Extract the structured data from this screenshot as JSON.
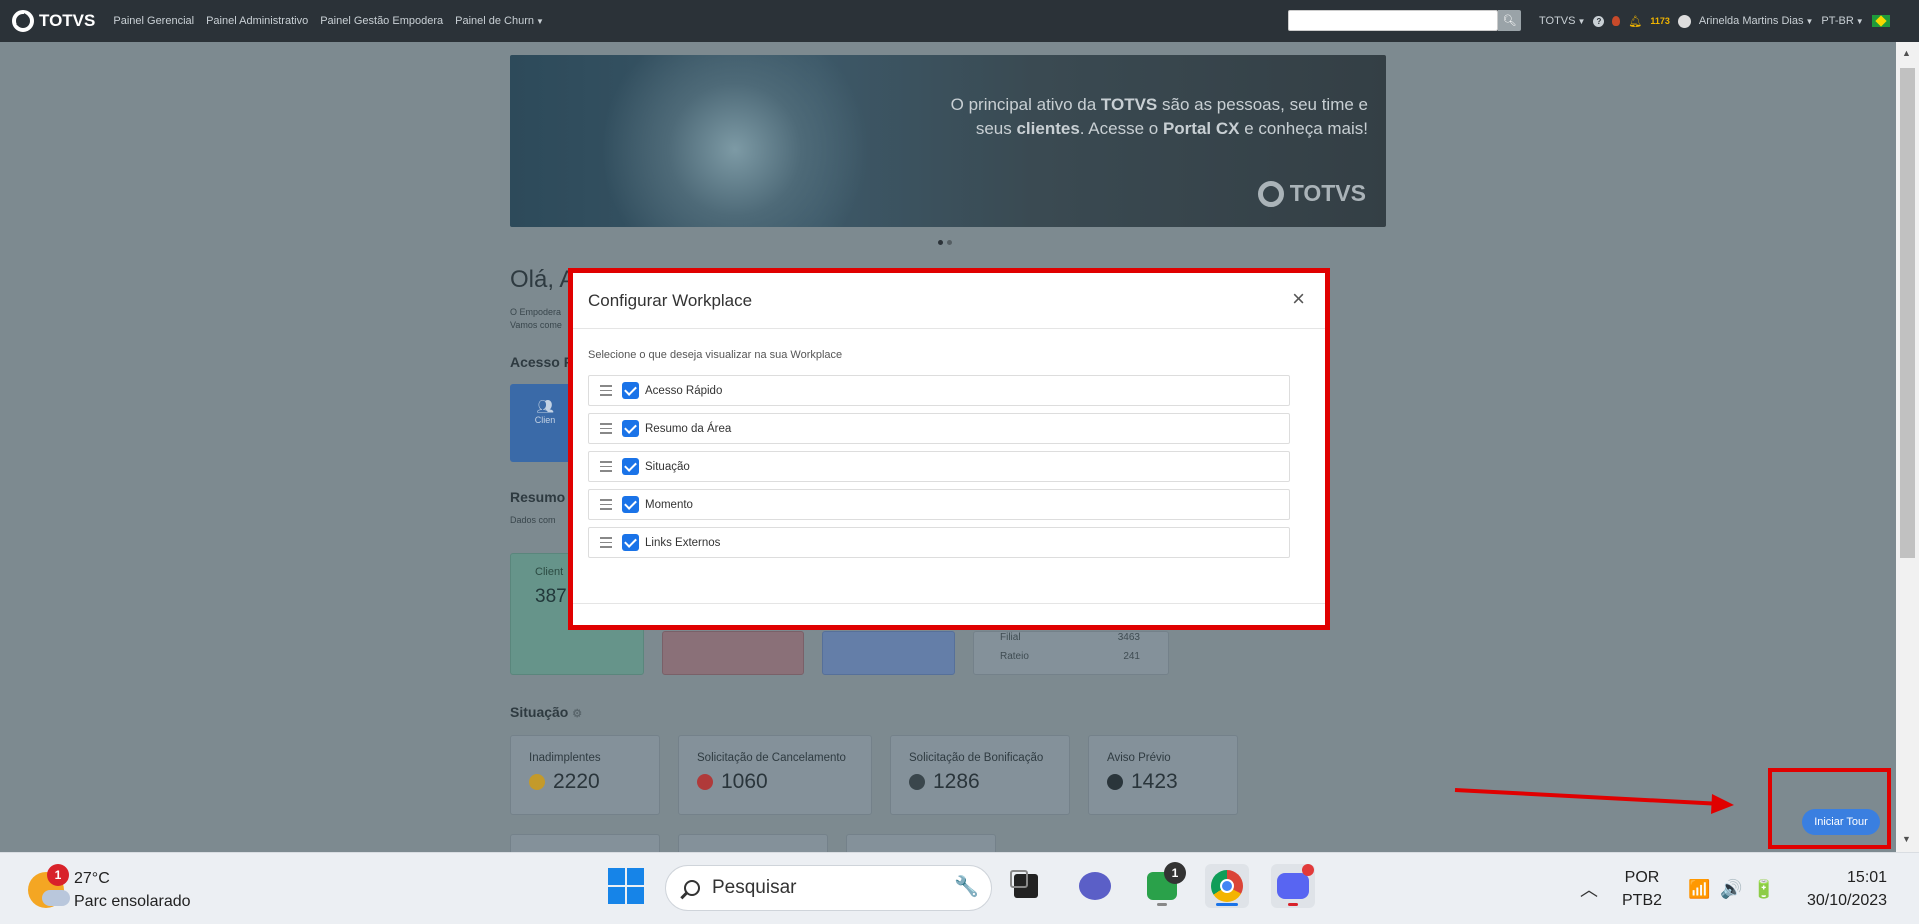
{
  "navbar": {
    "brand": "TOTVS",
    "links": [
      "Painel Gerencial",
      "Painel Administrativo",
      "Painel Gestão Empodera",
      "Painel de Churn"
    ],
    "org_menu": "TOTVS",
    "notification_count": "1173",
    "user_name": "Arinelda Martins Dias",
    "language": "PT-BR"
  },
  "banner": {
    "line1_pre": "O principal ativo da ",
    "line1_bold": "TOTVS",
    "line1_post": " são as pessoas, seu time e",
    "line2_pre": "seus ",
    "line2_bold1": "clientes",
    "line2_mid": ". Acesse o ",
    "line2_bold2": "Portal CX",
    "line2_post": " e conheça mais!",
    "logo": "TOTVS"
  },
  "background": {
    "greeting": "Olá, A",
    "sub_line1": "O Empodera",
    "sub_line2": "Vamos come",
    "quick_access_title": "Acesso R",
    "quick_tile_label": "Clien",
    "summary_title": "Resumo",
    "summary_sub": "Dados com",
    "summary_card_label": "Client",
    "summary_card_value": "387",
    "stats": [
      {
        "label": "Filial",
        "value": "3463"
      },
      {
        "label": "Rateio",
        "value": "241"
      }
    ],
    "situacao_title": "Situação",
    "situacao_cards": [
      {
        "label": "Inadimplentes",
        "value": "2220",
        "icon": "search-money-icon",
        "color": "#c49a2a"
      },
      {
        "label": "Solicitação de Cancelamento",
        "value": "1060",
        "icon": "bomb-icon",
        "color": "#b03a3a"
      },
      {
        "label": "Solicitação de Bonificação",
        "value": "1286",
        "icon": "dollar-bubble-icon",
        "color": "#3a464c"
      },
      {
        "label": "Aviso Prévio",
        "value": "1423",
        "icon": "exclamation-icon",
        "color": "#2a353b"
      }
    ]
  },
  "modal": {
    "title": "Configurar Workplace",
    "close": "×",
    "description": "Selecione o que deseja visualizar na sua Workplace",
    "options": [
      {
        "label": "Acesso Rápido",
        "checked": true
      },
      {
        "label": "Resumo da Área",
        "checked": true
      },
      {
        "label": "Situação",
        "checked": true
      },
      {
        "label": "Momento",
        "checked": true
      },
      {
        "label": "Links Externos",
        "checked": true
      }
    ]
  },
  "tour_button": "Iniciar Tour",
  "taskbar": {
    "weather_badge": "1",
    "temperature": "27°C",
    "weather_desc": "Parc ensolarado",
    "search_placeholder": "Pesquisar",
    "chat_badge": "1",
    "language_line1": "POR",
    "language_line2": "PTB2",
    "time": "15:01",
    "date": "30/10/2023"
  }
}
